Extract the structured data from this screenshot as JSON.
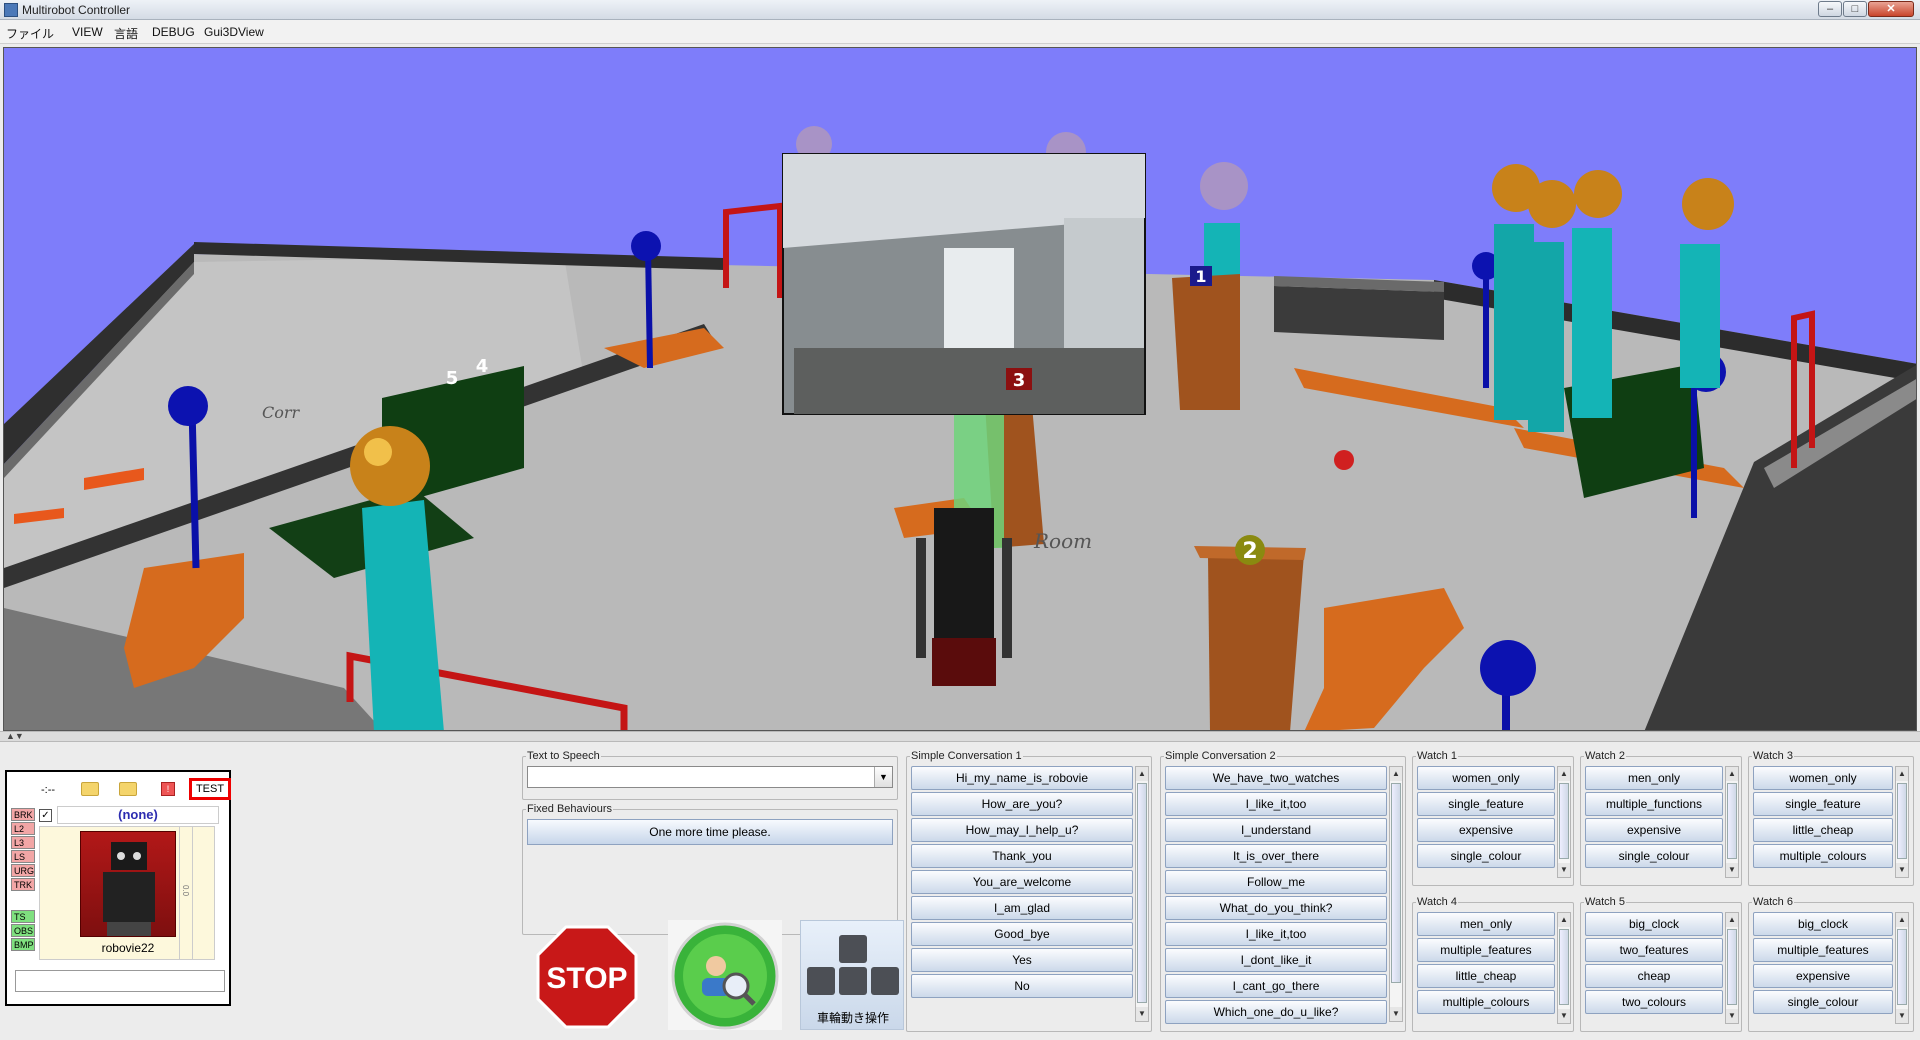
{
  "window": {
    "title": "Multirobot Controller",
    "btn_min": "–",
    "btn_max": "□",
    "btn_close": "✕"
  },
  "menu": [
    "ファイル",
    "VIEW",
    "言語",
    "DEBUG",
    "Gui3DView"
  ],
  "scene": {
    "labels": [
      "1",
      "2",
      "3",
      "4",
      "5"
    ],
    "floor_text_1": "Room",
    "floor_text_2": "Corr"
  },
  "robot_panel": {
    "dash": "-:--",
    "log_icon": "!",
    "test_label": "TEST",
    "selected": "(none)",
    "robot_name": "robovie22",
    "check": "✓",
    "scroll_text": "0.0",
    "status_tags": [
      "BRK",
      "L2",
      "L3",
      "LS",
      "URG",
      "TRK",
      "TS",
      "OBS",
      "BMP"
    ]
  },
  "tts": {
    "legend": "Text to Speech",
    "value": ""
  },
  "fixed": {
    "legend": "Fixed Behaviours",
    "button": "One more time please."
  },
  "conv1": {
    "legend": "Simple Conversation 1",
    "items": [
      "Hi_my_name_is_robovie",
      "How_are_you?",
      "How_may_I_help_u?",
      "Thank_you",
      "You_are_welcome",
      "I_am_glad",
      "Good_bye",
      "Yes",
      "No"
    ]
  },
  "conv2": {
    "legend": "Simple Conversation 2",
    "items": [
      "We_have_two_watches",
      "I_like_it,too",
      "I_understand",
      "It_is_over_there",
      "Follow_me",
      "What_do_you_think?",
      "I_like_it,too",
      "I_dont_like_it",
      "I_cant_go_there",
      "Which_one_do_u_like?"
    ]
  },
  "watches": [
    {
      "legend": "Watch 1",
      "items": [
        "women_only",
        "single_feature",
        "expensive",
        "single_colour"
      ]
    },
    {
      "legend": "Watch 2",
      "items": [
        "men_only",
        "multiple_functions",
        "expensive",
        "single_colour"
      ]
    },
    {
      "legend": "Watch 3",
      "items": [
        "women_only",
        "single_feature",
        "little_cheap",
        "multiple_colours"
      ]
    },
    {
      "legend": "Watch 4",
      "items": [
        "men_only",
        "multiple_features",
        "little_cheap",
        "multiple_colours"
      ]
    },
    {
      "legend": "Watch 5",
      "items": [
        "big_clock",
        "two_features",
        "cheap",
        "two_colours"
      ]
    },
    {
      "legend": "Watch 6",
      "items": [
        "big_clock",
        "multiple_features",
        "expensive",
        "single_colour"
      ]
    }
  ],
  "actions": {
    "stop": "STOP",
    "arrow_label": "車輪動き操作"
  },
  "scroll": {
    "up": "▲",
    "down": "▼",
    "combo": "▼"
  }
}
